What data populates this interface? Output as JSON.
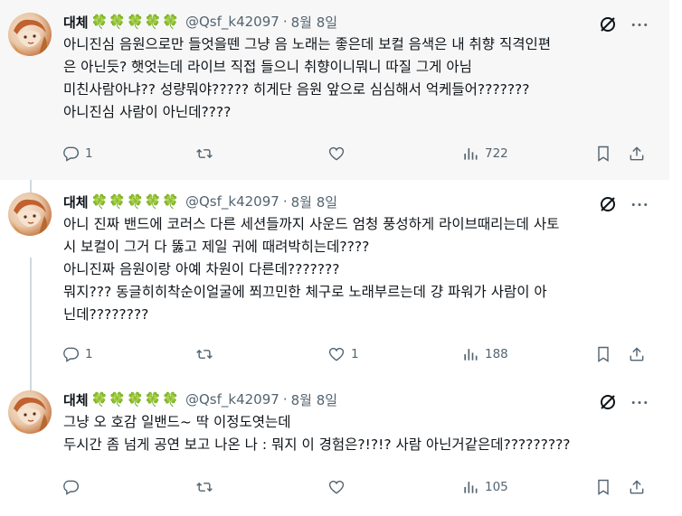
{
  "tweets": [
    {
      "author_name": "대체",
      "clovers": "🍀🍀🍀🍀🍀",
      "handle": "@Qsf_k42097",
      "separator": "·",
      "date": "8월 8일",
      "lines": [
        "아니진심 음원으로만 들엇을뗀 그냥 음 노래는 좋은데 보컬 음색은 내 취향 직격인편",
        "은 아닌듯? 햇엇는데 라이브 직접 들으니 취향이니뭐니 따질 그게 아님",
        "미친사람아냐?? 성량뭐야????? 히게단 음원 앞으로 심심해서 억케들어???????",
        "아니진심 사람이 아닌데????"
      ],
      "reply_count": "1",
      "retweet_count": "",
      "like_count": "",
      "view_count": "722"
    },
    {
      "author_name": "대체",
      "clovers": "🍀🍀🍀🍀🍀",
      "handle": "@Qsf_k42097",
      "separator": "·",
      "date": "8월 8일",
      "lines": [
        "아니 진짜 밴드에 코러스 다른 세션들까지 사운드 엄청 풍성하게 라이브때리는데 사토",
        "시 보컬이 그거 다 뚫고 제일 귀에 때려박히는데????",
        "아니진짜 음원이랑 아예 차원이 다른데???????",
        "뭐지??? 동글히히착순이얼굴에 쬐끄민한 체구로 노래부르는데 걍 파워가 사람이 아",
        "닌데????????"
      ],
      "reply_count": "1",
      "retweet_count": "",
      "like_count": "1",
      "view_count": "188"
    },
    {
      "author_name": "대체",
      "clovers": "🍀🍀🍀🍀🍀",
      "handle": "@Qsf_k42097",
      "separator": "·",
      "date": "8월 8일",
      "lines": [
        "그냥 오 호감 일밴드~ 딱 이정도엿는데",
        "두시간 좀 넘게 공연 보고 나온 나 : 뭐지 이 경험은?!?!? 사람 아닌거같은데?????????"
      ],
      "reply_count": "",
      "retweet_count": "",
      "like_count": "",
      "view_count": "105"
    }
  ],
  "colors": {
    "text": "#0f1419",
    "secondary": "#536471",
    "thread_line": "#cfd9de",
    "highlight_bg": "#f7f7f7",
    "clover": "#2ea043"
  }
}
